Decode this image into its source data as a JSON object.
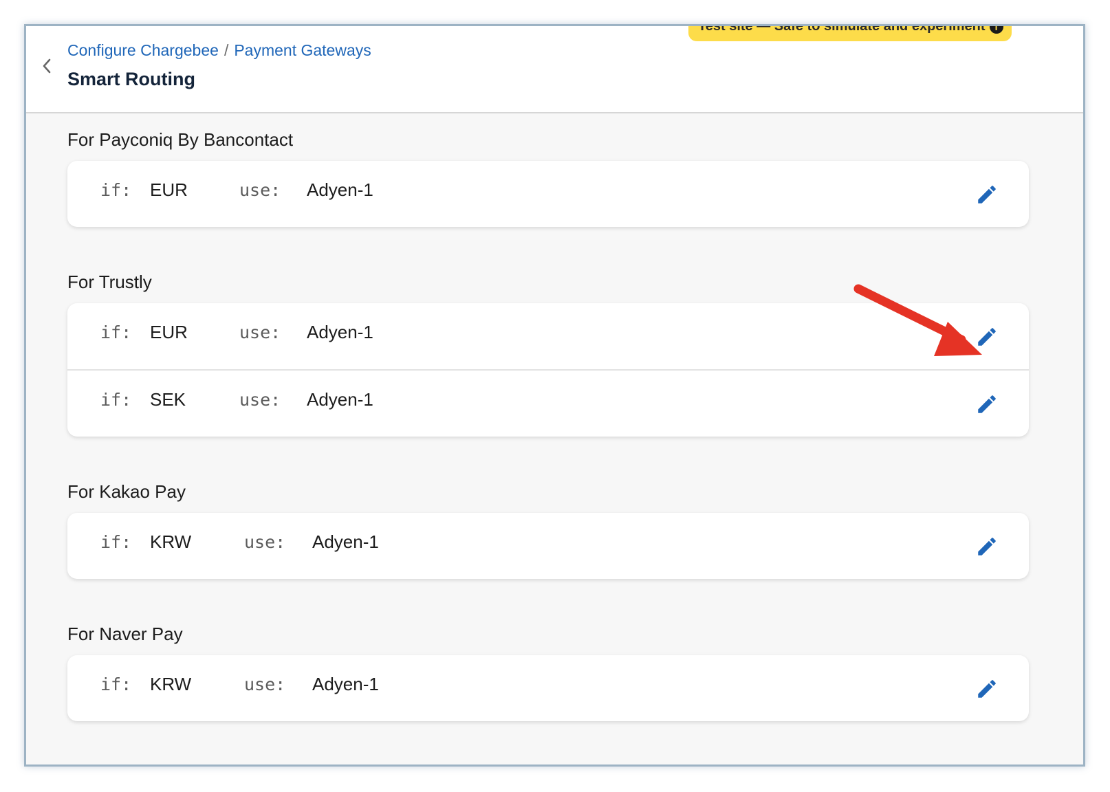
{
  "header": {
    "breadcrumb": [
      "Configure Chargebee",
      "Payment Gateways"
    ],
    "breadcrumb_separator": "/",
    "title": "Smart Routing",
    "test_banner": "Test site — Safe to simulate and experiment",
    "test_banner_icon": "info-icon"
  },
  "sections": [
    {
      "title": "For Payconiq By Bancontact",
      "rules": [
        {
          "if_label": "if:",
          "currency": "EUR",
          "use_label": "use:",
          "gateway": "Adyen-1"
        }
      ]
    },
    {
      "title": "For Trustly",
      "rules": [
        {
          "if_label": "if:",
          "currency": "EUR",
          "use_label": "use:",
          "gateway": "Adyen-1"
        },
        {
          "if_label": "if:",
          "currency": "SEK",
          "use_label": "use:",
          "gateway": "Adyen-1"
        }
      ]
    },
    {
      "title": "For Kakao Pay",
      "rules": [
        {
          "if_label": "if:",
          "currency": "KRW",
          "use_label": "use:",
          "gateway": "Adyen-1"
        }
      ]
    },
    {
      "title": "For Naver Pay",
      "rules": [
        {
          "if_label": "if:",
          "currency": "KRW",
          "use_label": "use:",
          "gateway": "Adyen-1"
        }
      ]
    }
  ],
  "colors": {
    "link": "#1f66b8",
    "edit_icon": "#1f66b8",
    "banner": "#fddc4a",
    "annotation_arrow": "#e53325"
  },
  "icons": {
    "back": "chevron-left-icon",
    "edit": "pencil-icon"
  }
}
